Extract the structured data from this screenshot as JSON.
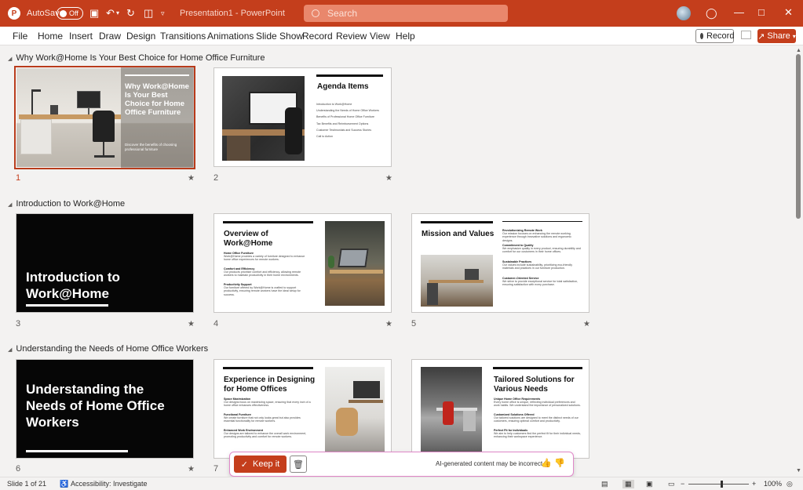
{
  "titlebar": {
    "autosave_label": "AutoSave",
    "autosave_state": "Off",
    "document_title": "Presentation1  -  PowerPoint",
    "search_placeholder": "Search"
  },
  "ribbon": {
    "tabs": [
      "File",
      "Home",
      "Insert",
      "Draw",
      "Design",
      "Transitions",
      "Animations",
      "Slide Show",
      "Record",
      "Review",
      "View",
      "Help"
    ],
    "record_label": "Record",
    "share_label": "Share"
  },
  "sections": [
    "Why Work@Home Is Your Best Choice for Home Office Furniture",
    "Introduction to Work@Home",
    "Understanding the Needs of Home Office Workers"
  ],
  "slides": {
    "s1": {
      "num": "1",
      "title": "Why Work@Home Is Your Best Choice for Home Office Furniture",
      "subtitle": "Discover the benefits of choosing professional furniture"
    },
    "s2": {
      "num": "2",
      "title": "Agenda Items",
      "items": [
        "Introduction to Work@Home",
        "Understanding the Needs of Home Office Workers",
        "Benefits of Professional Home Office Furniture",
        "Tax Benefits and Reimbursement Options",
        "Customer Testimonials and Success Stories",
        "Call to Action"
      ]
    },
    "s3": {
      "num": "3",
      "title": "Introduction to Work@Home"
    },
    "s4": {
      "num": "4",
      "title": "Overview of Work@Home",
      "items": [
        {
          "h": "Home Office Furniture",
          "t": "Work@Home provides a variety of furniture designed to enhance home office experiences for remote workers."
        },
        {
          "h": "Comfort and Efficiency",
          "t": "Our products prioritize comfort and efficiency, allowing remote workers to maintain productivity in their home environments."
        },
        {
          "h": "Productivity Support",
          "t": "Our furniture offered by Work@Home is crafted to support productivity, ensuring remote workers have the ideal setup for success."
        }
      ]
    },
    "s5": {
      "num": "5",
      "title": "Mission and Values",
      "items": [
        {
          "h": "Revolutionizing Remote Work",
          "t": "Our mission focuses on enhancing the remote working experience through innovative solutions and ergonomic designs."
        },
        {
          "h": "Commitment to Quality",
          "t": "We emphasize quality in every product, ensuring durability and comfort for our customers in their home offices."
        },
        {
          "h": "Sustainable Practices",
          "t": "Our values include sustainability, prioritizing eco-friendly materials and practices in our furniture production."
        },
        {
          "h": "Customer-Oriented Service",
          "t": "We strive to provide exceptional service for total satisfaction, ensuring satisfaction with every purchase."
        }
      ]
    },
    "s6": {
      "num": "6",
      "title": "Understanding the Needs of Home Office Workers"
    },
    "s7": {
      "num": "7",
      "title": "Experience in Designing for Home Offices",
      "items": [
        {
          "h": "Space Maximization",
          "t": "Our designs focus on maximizing space, ensuring that every inch of a home office enhances effectiveness."
        },
        {
          "h": "Functional Furniture",
          "t": "We create furniture that not only looks great but also provides essential functionality for remote workers."
        },
        {
          "h": "Enhanced Work Environment",
          "t": "Our designs are tailored to enhance the overall work environment, promoting productivity and comfort for remote workers."
        }
      ]
    },
    "s8": {
      "title": "Tailored Solutions for Various Needs",
      "items": [
        {
          "h": "Unique Home Office Requirements",
          "t": "Every home office is unique, reflecting individual preferences and work habits. We understand the importance of personalized solutions."
        },
        {
          "h": "Customized Solutions Offered",
          "t": "Our tailored solutions are designed to meet the distinct needs of our customers, ensuring optimal comfort and productivity."
        },
        {
          "h": "Perfect Fit for Individuals",
          "t": "We aim to help customers find the perfect fit for their individual needs, enhancing their workspace experience."
        }
      ]
    }
  },
  "ai_bar": {
    "keep_label": "Keep it",
    "note": "AI-generated content may be incorrect"
  },
  "status": {
    "slide_info": "Slide 1 of 21",
    "accessibility": "Accessibility: Investigate",
    "zoom": "100%"
  }
}
